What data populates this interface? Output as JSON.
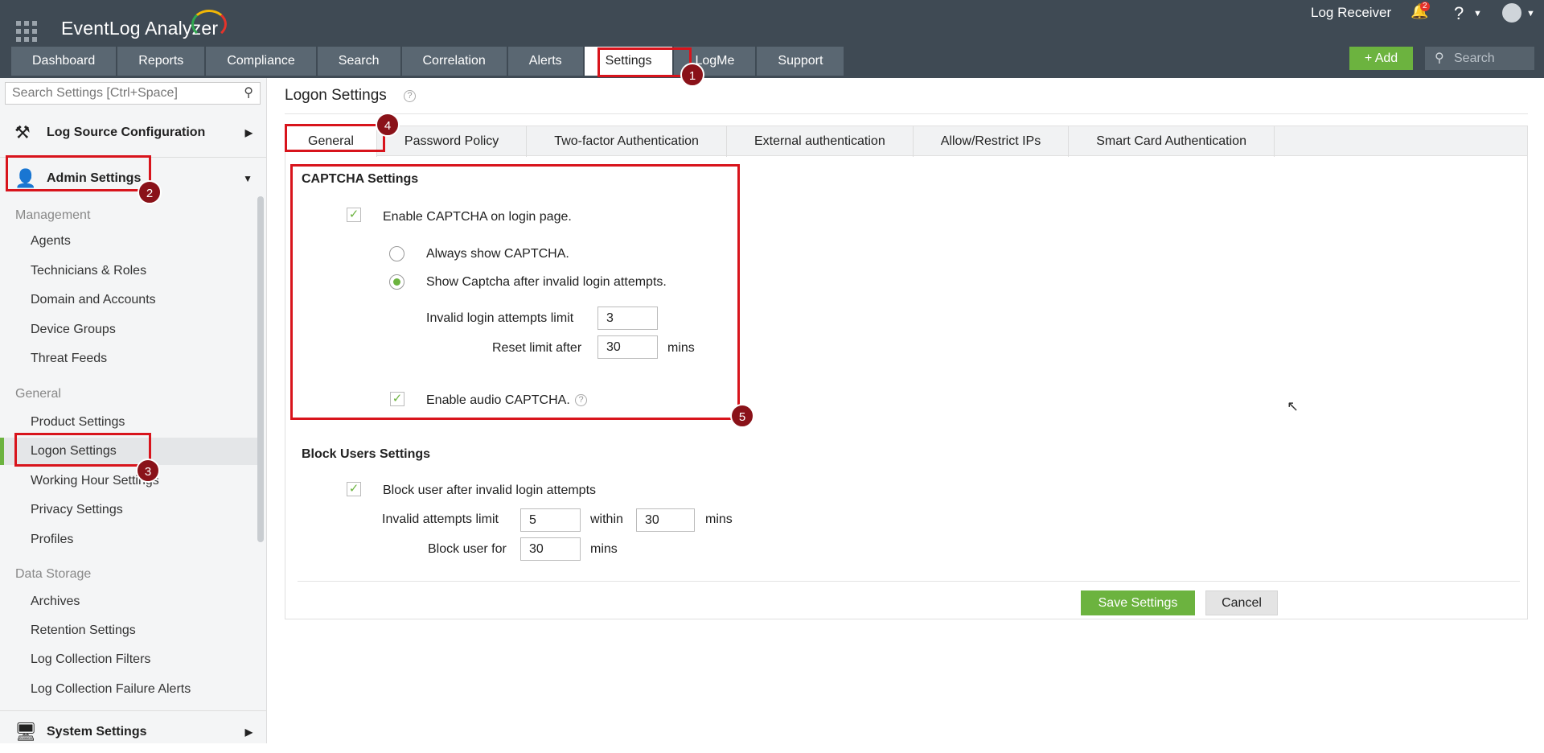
{
  "header": {
    "app_name": "EventLog Analyzer",
    "log_receiver": "Log Receiver",
    "notification_count": "2",
    "help": "?",
    "add_label": "Add",
    "search_placeholder": "Search",
    "nav_tabs": [
      "Dashboard",
      "Reports",
      "Compliance",
      "Search",
      "Correlation",
      "Alerts",
      "Settings",
      "LogMe",
      "Support"
    ],
    "active_tab": "Settings"
  },
  "sidebar": {
    "search_placeholder": "Search Settings [Ctrl+Space]",
    "log_source": "Log Source Configuration",
    "admin_settings": "Admin Settings",
    "system_settings": "System Settings",
    "sections": {
      "management": "Management",
      "general": "General",
      "data_storage": "Data Storage"
    },
    "management_items": [
      "Agents",
      "Technicians & Roles",
      "Domain and Accounts",
      "Device Groups",
      "Threat Feeds"
    ],
    "general_items": [
      "Product Settings",
      "Logon Settings",
      "Working Hour Settings",
      "Privacy Settings",
      "Profiles"
    ],
    "data_items": [
      "Archives",
      "Retention Settings",
      "Log Collection Filters",
      "Log Collection Failure Alerts"
    ],
    "active_item": "Logon Settings"
  },
  "page": {
    "title": "Logon Settings",
    "help": "?",
    "tabs": [
      "General",
      "Password Policy",
      "Two-factor Authentication",
      "External authentication",
      "Allow/Restrict IPs",
      "Smart Card Authentication"
    ],
    "active_tab": "General"
  },
  "captcha": {
    "title": "CAPTCHA Settings",
    "enable_label": "Enable CAPTCHA on login page.",
    "enabled": true,
    "always_label": "Always show CAPTCHA.",
    "after_invalid_label": "Show Captcha after invalid login attempts.",
    "selected_mode": "after_invalid",
    "limit_label": "Invalid login attempts limit",
    "limit_value": "3",
    "reset_label": "Reset limit after",
    "reset_value": "30",
    "reset_unit": "mins",
    "audio_label": "Enable audio CAPTCHA.",
    "audio_enabled": true,
    "help": "?"
  },
  "block_users": {
    "title": "Block Users Settings",
    "enable_label": "Block user after invalid login attempts",
    "enabled": true,
    "attempts_label": "Invalid attempts limit",
    "attempts_value": "5",
    "within_label": "within",
    "within_value": "30",
    "within_unit": "mins",
    "block_for_label": "Block user for",
    "block_for_value": "30",
    "block_for_unit": "mins"
  },
  "actions": {
    "save": "Save Settings",
    "cancel": "Cancel"
  },
  "annotations": [
    "1",
    "2",
    "3",
    "4",
    "5"
  ],
  "colors": {
    "accent_green": "#6cb33f",
    "topbar": "#3f4a54",
    "nav_tab": "#5a6772",
    "annotation_red": "#d8141c",
    "marker": "#8a1219"
  }
}
